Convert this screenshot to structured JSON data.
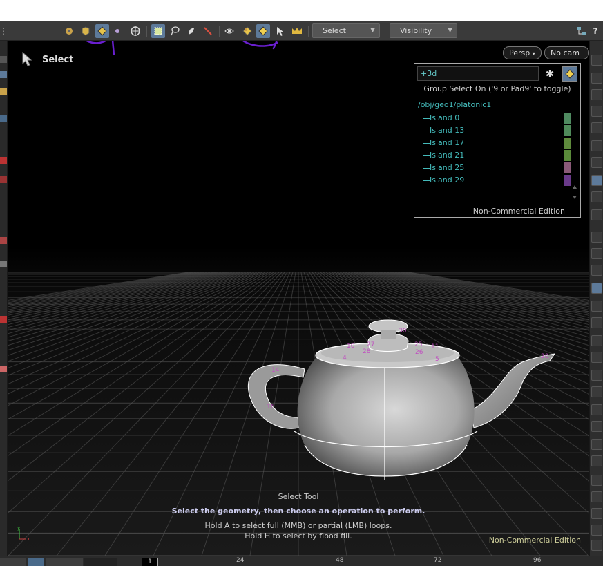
{
  "toolbar": {
    "select_mode_label": "Select",
    "visibility_label": "Visibility"
  },
  "viewport": {
    "tool_title": "Select",
    "camera_view": "Persp",
    "camera": "No cam",
    "hint_title": "Select Tool",
    "hint_bold": "Select the geometry, then choose an operation to perform.",
    "hint_line1": "Hold A to select full (MMB) or partial (LMB) loops.",
    "hint_line2": "Hold H to select by flood fill.",
    "edition": "Non-Commercial Edition"
  },
  "group_panel": {
    "input_value": "+3d",
    "message": "Group Select On ('9 or Pad9' to toggle)",
    "path": "/obj/geo1/platonic1",
    "islands": [
      {
        "label": "Island 0",
        "color": "#4f8a60"
      },
      {
        "label": "Island 13",
        "color": "#4f8a5a"
      },
      {
        "label": "Island 17",
        "color": "#5e8a3c"
      },
      {
        "label": "Island 21",
        "color": "#5a8a3a"
      },
      {
        "label": "Island 25",
        "color": "#8a5a78"
      },
      {
        "label": "Island 29",
        "color": "#6a3a8a"
      }
    ],
    "edition": "Non-Commercial Edition"
  },
  "teapot_labels": [
    "30",
    "10",
    "27",
    "25",
    "11",
    "28",
    "26",
    "4",
    "5",
    "14",
    "16",
    "20"
  ],
  "timeline": {
    "current_frame": "1",
    "ticks": [
      "24",
      "48",
      "72",
      "96"
    ]
  },
  "colors": {
    "accent": "#5d7a9a",
    "annotation": "#6a1fd0",
    "path_text": "#44bbbb"
  }
}
